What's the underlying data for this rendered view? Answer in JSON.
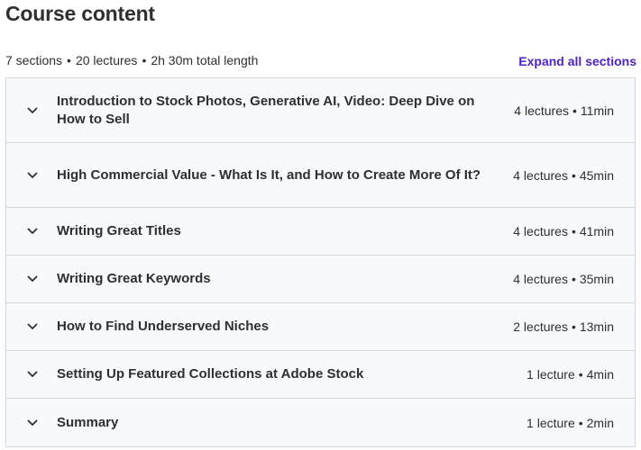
{
  "header": {
    "title": "Course content"
  },
  "summary": {
    "sections": "7 sections",
    "lectures": "20 lectures",
    "length": "2h 30m total length",
    "separator": "•",
    "expand_label": "Expand all sections"
  },
  "sections": [
    {
      "title": "Introduction to Stock Photos, Generative AI, Video: Deep Dive on How to Sell",
      "lectures": "4 lectures",
      "duration": "11min"
    },
    {
      "title": "High Commercial Value - What Is It, and How to Create More Of It?",
      "lectures": "4 lectures",
      "duration": "45min"
    },
    {
      "title": "Writing Great Titles",
      "lectures": "4 lectures",
      "duration": "41min"
    },
    {
      "title": "Writing Great Keywords",
      "lectures": "4 lectures",
      "duration": "35min"
    },
    {
      "title": "How to Find Underserved Niches",
      "lectures": "2 lectures",
      "duration": "13min"
    },
    {
      "title": "Setting Up Featured Collections at Adobe Stock",
      "lectures": "1 lecture",
      "duration": "4min"
    },
    {
      "title": "Summary",
      "lectures": "1 lecture",
      "duration": "2min"
    }
  ],
  "icons": {
    "section_toggle": "chevron-down-icon"
  },
  "colors": {
    "accent": "#5022c3",
    "text": "#2d2f31",
    "panel_bg": "#f7f9fa",
    "border": "#d1d7dc"
  }
}
